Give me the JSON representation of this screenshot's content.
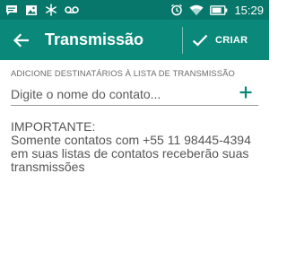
{
  "status_bar": {
    "time": "15:29",
    "left_icons": [
      "message-icon",
      "image-icon",
      "snowflake-icon",
      "voicemail-icon"
    ],
    "right_icons": [
      "alarm-icon",
      "wifi-icon",
      "battery-icon"
    ]
  },
  "app_bar": {
    "title": "Transmissão",
    "confirm_label": "CRIAR",
    "back_icon": "arrow-left-icon",
    "confirm_icon": "check-icon"
  },
  "recipients": {
    "section_label": "ADICIONE DESTINATÁRIOS À LISTA DE TRANSMISSÃO",
    "input_placeholder": "Digite o nome do contato...",
    "input_value": "",
    "add_icon": "plus-icon"
  },
  "notice": {
    "heading": "IMPORTANTE:",
    "line1": "Somente contatos com +55 11 98445-4394",
    "line2": "em suas listas de contatos receberão suas",
    "line3": "transmissões"
  },
  "colors": {
    "status_bar": "#06776a",
    "app_bar": "#0a897b",
    "accent": "#0a897b"
  }
}
